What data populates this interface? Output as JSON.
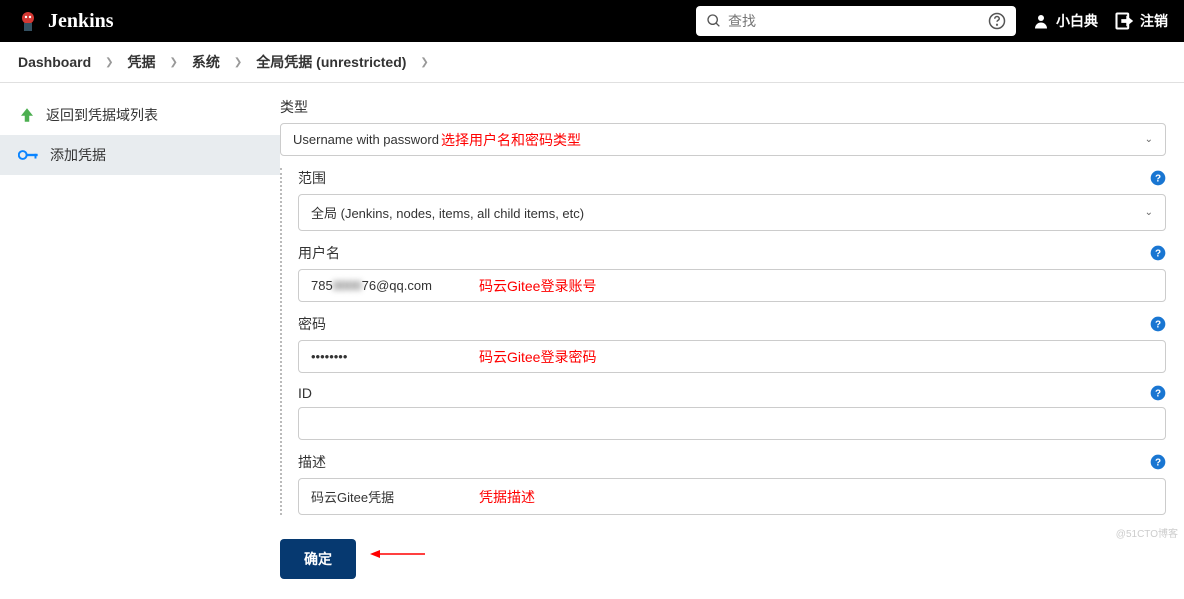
{
  "header": {
    "app_name": "Jenkins",
    "search_placeholder": "查找",
    "user_name": "小白典",
    "logout_label": "注销"
  },
  "breadcrumbs": [
    "Dashboard",
    "凭据",
    "系统",
    "全局凭据 (unrestricted)"
  ],
  "sidebar": {
    "items": [
      {
        "label": "返回到凭据域列表"
      },
      {
        "label": "添加凭据"
      }
    ]
  },
  "form": {
    "type_label": "类型",
    "type_value": "Username with password",
    "type_annotation": "选择用户名和密码类型",
    "scope_label": "范围",
    "scope_value": "全局 (Jenkins, nodes, items, all child items, etc)",
    "username_label": "用户名",
    "username_value": "785",
    "username_suffix": "76@qq.com",
    "username_annotation": "码云Gitee登录账号",
    "password_label": "密码",
    "password_value": "••••••••",
    "password_annotation": "码云Gitee登录密码",
    "id_label": "ID",
    "id_value": "",
    "description_label": "描述",
    "description_value": "码云Gitee凭据",
    "description_annotation": "凭据描述",
    "submit_label": "确定"
  },
  "watermark": "@51CTO博客"
}
